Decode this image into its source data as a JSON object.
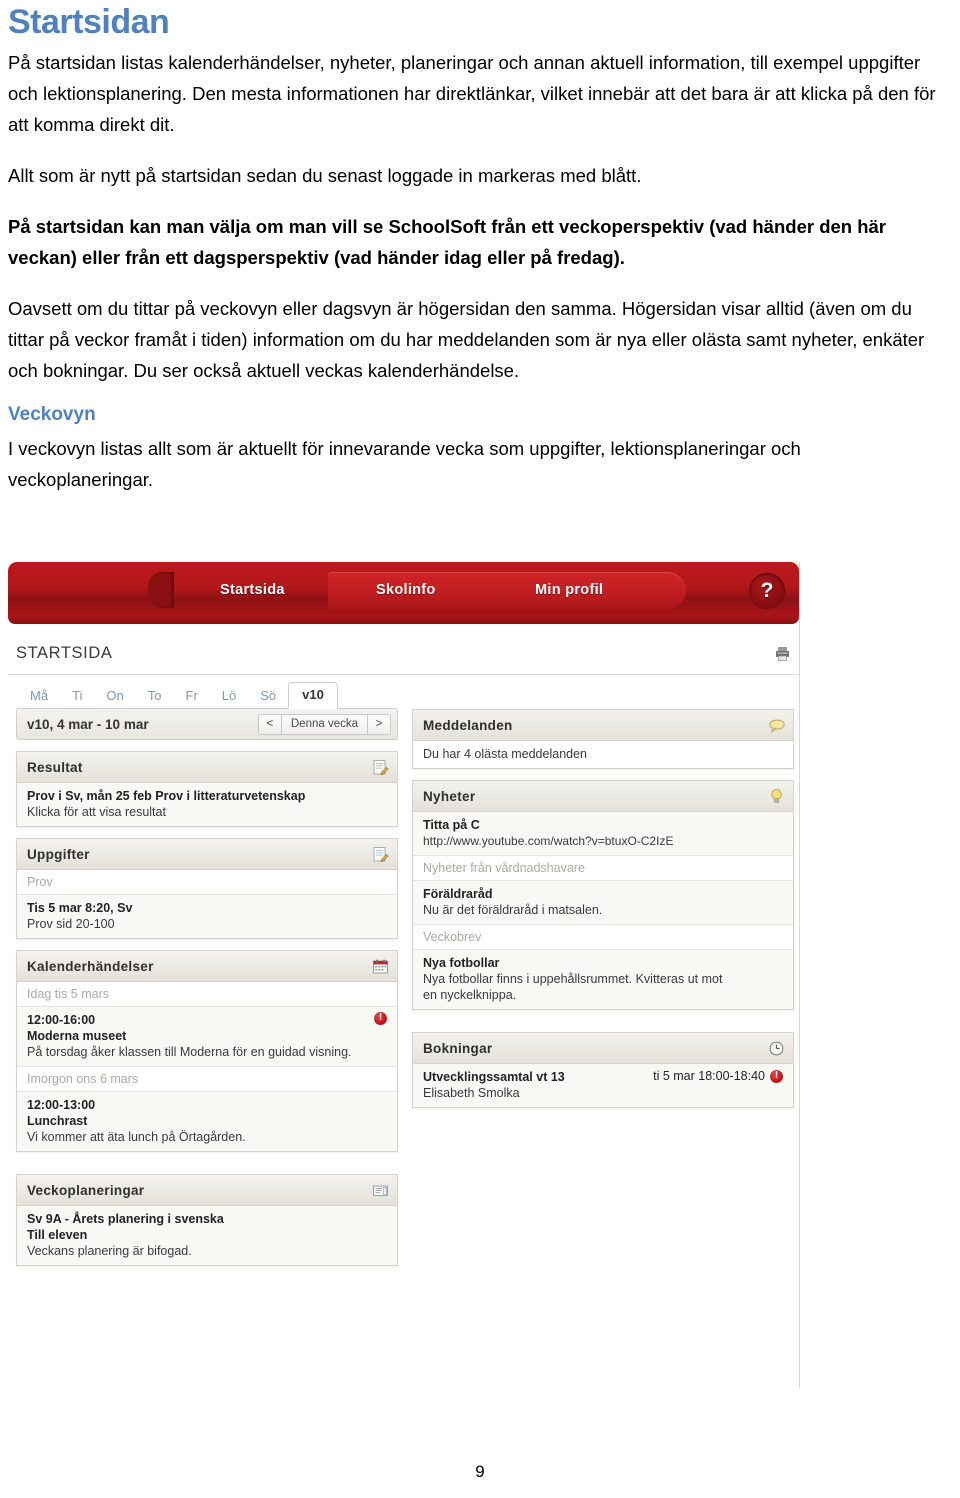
{
  "document": {
    "heading": "Startsidan",
    "paragraphs": [
      "På startsidan listas kalenderhändelser, nyheter, planeringar och annan aktuell information, till exempel uppgifter och lektionsplanering. Den mesta informationen har direktlänkar, vilket innebär att det bara är att klicka på den för att komma direkt dit.",
      "Allt som är nytt på startsidan sedan du senast loggade in markeras med blått.",
      "På startsidan kan man välja om man vill se SchoolSoft från ett veckoperspektiv (vad händer den här veckan) eller från ett dagsperspektiv (vad händer idag eller på fredag).",
      "Oavsett om du tittar på veckovyn eller dagsvyn är högersidan den samma. Högersidan visar alltid (även om du tittar på veckor framåt i tiden) information om du har meddelanden som är nya eller olästa samt nyheter, enkäter och bokningar. Du ser också aktuell veckas kalenderhändelse."
    ],
    "subheading": "Veckovyn",
    "subheading_paragraph": "I veckovyn listas allt som är aktuellt för innevarande vecka som uppgifter, lektionsplaneringar och veckoplaneringar.",
    "page_number": "9"
  },
  "colors": {
    "heading_blue": "#4f81bd",
    "nav_red": "#b0171a",
    "alert_red": "#c2161a",
    "panel_header_grey": "#e3e1d9"
  },
  "screenshot": {
    "navbar": {
      "items": [
        {
          "label": "Startsida",
          "active": true
        },
        {
          "label": "Skolinfo",
          "active": false
        },
        {
          "label": "Min profil",
          "active": false
        }
      ],
      "help_label": "?",
      "help_icon": "question-mark-icon"
    },
    "page_header": {
      "title": "STARTSIDA",
      "print_icon": "printer-icon"
    },
    "day_tabs": [
      {
        "label": "Må",
        "active": false
      },
      {
        "label": "Ti",
        "active": false
      },
      {
        "label": "On",
        "active": false
      },
      {
        "label": "To",
        "active": false
      },
      {
        "label": "Fr",
        "active": false
      },
      {
        "label": "Lö",
        "active": false
      },
      {
        "label": "Sö",
        "active": false
      },
      {
        "label": "v10",
        "active": true
      }
    ],
    "week_bar": {
      "range": "v10, 4 mar - 10 mar",
      "prev": "<",
      "current": "Denna vecka",
      "next": ">"
    },
    "left_panels": [
      {
        "title": "Resultat",
        "icon": "edit-note-icon",
        "rows": [
          {
            "type": "item",
            "shade": "alt",
            "title": "Prov i Sv, mån 25 feb Prov i litteraturvetenskap",
            "text": "Klicka för att visa resultat"
          }
        ]
      },
      {
        "title": "Uppgifter",
        "icon": "edit-note-icon",
        "rows": [
          {
            "type": "subhead",
            "title": "Prov"
          },
          {
            "type": "item",
            "shade": "alt",
            "title": "Tis 5 mar 8:20, Sv",
            "text": "Prov sid 20-100"
          }
        ]
      },
      {
        "title": "Kalenderhändelser",
        "icon": "calendar-icon",
        "rows": [
          {
            "type": "subhead",
            "title": "Idag tis 5 mars"
          },
          {
            "type": "item",
            "shade": "alt",
            "time": "12:00-16:00",
            "title": "Moderna museet",
            "text": "På torsdag åker klassen till Moderna för en guidad visning.",
            "alert": true
          },
          {
            "type": "subhead",
            "title": "Imorgon ons 6 mars"
          },
          {
            "type": "item",
            "shade": "alt",
            "time": "12:00-13:00",
            "title": "Lunchrast",
            "text": "Vi kommer att äta lunch på Örtagården."
          }
        ]
      },
      {
        "title": "Veckoplaneringar",
        "icon": "document-lines-icon",
        "rows": [
          {
            "type": "item",
            "shade": "alt",
            "title": "Sv 9A - Årets planering i svenska",
            "subtitle": "Till eleven",
            "text": "Veckans planering är bifogad."
          }
        ]
      }
    ],
    "right_panels": [
      {
        "title": "Meddelanden",
        "icon": "speech-bubble-icon",
        "rows": [
          {
            "type": "item",
            "shade": "plain",
            "text": "Du har 4 olästa meddelanden"
          }
        ]
      },
      {
        "title": "Nyheter",
        "icon": "lightbulb-icon",
        "rows": [
          {
            "type": "item",
            "shade": "alt",
            "title": "Titta på C",
            "link": "http://www.youtube.com/watch?v=btuxO-C2IzE"
          },
          {
            "type": "subhead",
            "title": "Nyheter från vårdnadshavare"
          },
          {
            "type": "item",
            "shade": "alt",
            "title": "Föräldraråd",
            "text": "Nu är det föräldraråd i matsalen."
          },
          {
            "type": "subhead",
            "title": "Veckobrev"
          },
          {
            "type": "item",
            "shade": "alt",
            "title": "Nya fotbollar",
            "text": "Nya fotbollar finns i uppehållsrummet. Kvitteras ut mot en nyckelknippa."
          }
        ]
      },
      {
        "title": "Bokningar",
        "icon": "clock-icon",
        "rows": [
          {
            "type": "item",
            "shade": "alt",
            "title": "Utvecklingssamtal vt 13",
            "text": "Elisabeth Smolka",
            "meta": "ti 5 mar 18:00-18:40",
            "alert": true
          }
        ]
      }
    ]
  }
}
